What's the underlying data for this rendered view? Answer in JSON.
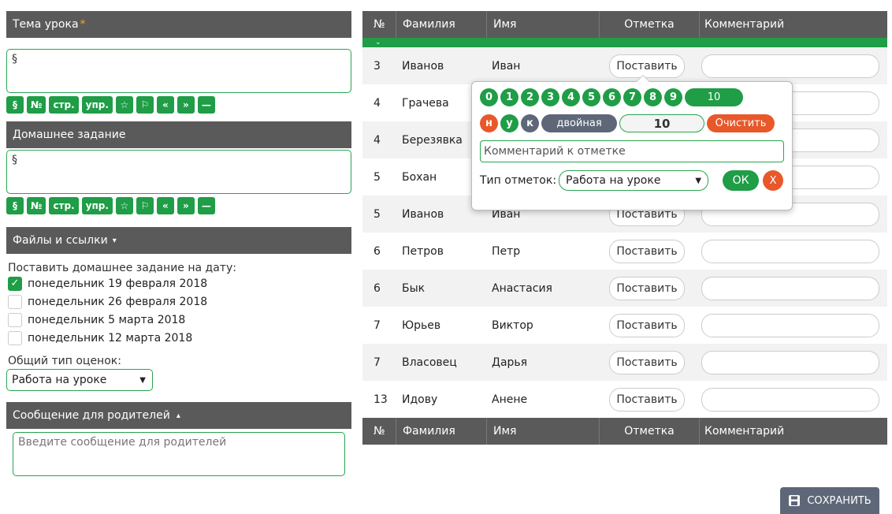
{
  "left": {
    "topic": {
      "title": "Тема урока",
      "required_mark": "*",
      "value": "§"
    },
    "formatting_buttons": [
      "§",
      "№",
      "стр.",
      "упр.",
      "☆",
      "⚐",
      "«",
      "»",
      "—"
    ],
    "homework": {
      "title": "Домашнее задание",
      "value": "§"
    },
    "files": {
      "title": "Файлы и ссылки",
      "arrow": "▾"
    },
    "homework_date": {
      "label": "Поставить домашнее задание на дату:",
      "options": [
        {
          "text": "понедельник 19 февраля 2018",
          "checked": true
        },
        {
          "text": "понедельник 26 февраля 2018",
          "checked": false
        },
        {
          "text": "понедельник 5 марта 2018",
          "checked": false
        },
        {
          "text": "понедельник 12 марта 2018",
          "checked": false
        }
      ]
    },
    "grade_type": {
      "label": "Общий тип оценок:",
      "value": "Работа на уроке"
    },
    "parents_message": {
      "title": "Сообщение для родителей",
      "arrow": "▴",
      "placeholder": "Введите сообщение для родителей"
    }
  },
  "table": {
    "columns": [
      "№",
      "Фамилия",
      "Имя",
      "Отметка",
      "Комментарий"
    ],
    "rows": [
      {
        "no": "3",
        "surname": "Иванов",
        "name": "Иван",
        "mark": "Поставить"
      },
      {
        "no": "4",
        "surname": "Грачева",
        "name": "",
        "mark": ""
      },
      {
        "no": "4",
        "surname": "Березявка",
        "name": "",
        "mark": ""
      },
      {
        "no": "5",
        "surname": "Бохан",
        "name": "",
        "mark": ""
      },
      {
        "no": "5",
        "surname": "Иванов",
        "name": "Иван",
        "mark": "Поставить"
      },
      {
        "no": "6",
        "surname": "Петров",
        "name": "Петр",
        "mark": "Поставить"
      },
      {
        "no": "6",
        "surname": "Бык",
        "name": "Анастасия",
        "mark": "Поставить"
      },
      {
        "no": "7",
        "surname": "Юрьев",
        "name": "Виктор",
        "mark": "Поставить"
      },
      {
        "no": "7",
        "surname": "Власовец",
        "name": "Дарья",
        "mark": "Поставить"
      },
      {
        "no": "13",
        "surname": "Идову",
        "name": "Анене",
        "mark": "Поставить"
      }
    ]
  },
  "popup": {
    "grades": [
      "0",
      "1",
      "2",
      "3",
      "4",
      "5",
      "6",
      "7",
      "8",
      "9",
      "10"
    ],
    "special": [
      "н",
      "у",
      "к"
    ],
    "double_label": "двойная",
    "current_value": "10",
    "clear_label": "Очистить",
    "comment_placeholder": "Комментарий к отметке",
    "type_label": "Тип отметок:",
    "type_value": "Работа на уроке",
    "ok_label": "ОК",
    "close_label": "X"
  },
  "save_label": "СОХРАНИТЬ",
  "colors": {
    "green": "#1f9d47",
    "dark": "#5a5a5a",
    "orange": "#e8582a",
    "slate": "#5e6778"
  }
}
